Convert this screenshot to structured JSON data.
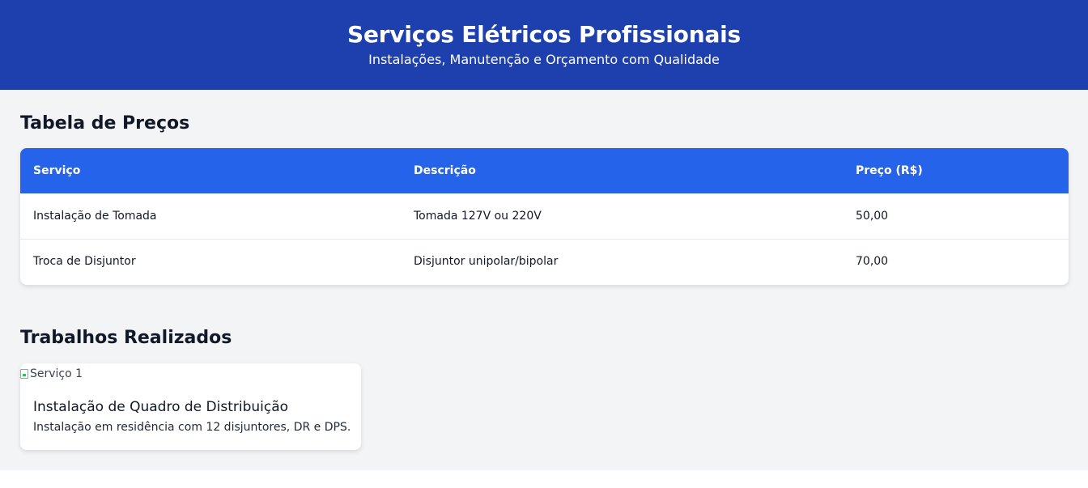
{
  "header": {
    "title": "Serviços Elétricos Profissionais",
    "subtitle": "Instalações, Manutenção e Orçamento com Qualidade"
  },
  "prices": {
    "title": "Tabela de Preços",
    "columns": [
      "Serviço",
      "Descrição",
      "Preço (R$)"
    ],
    "rows": [
      [
        "Instalação de Tomada",
        "Tomada 127V ou 220V",
        "50,00"
      ],
      [
        "Troca de Disjuntor",
        "Disjuntor unipolar/bipolar",
        "70,00"
      ]
    ]
  },
  "works": {
    "title": "Trabalhos Realizados",
    "items": [
      {
        "image_alt": "Serviço 1",
        "title": "Instalação de Quadro de Distribuição",
        "description": "Instalação em residência com 12 disjuntores, DR e DPS."
      }
    ]
  },
  "colors": {
    "header_bg": "#1e40af",
    "table_header_bg": "#2563eb",
    "page_bg": "#f3f4f6"
  }
}
